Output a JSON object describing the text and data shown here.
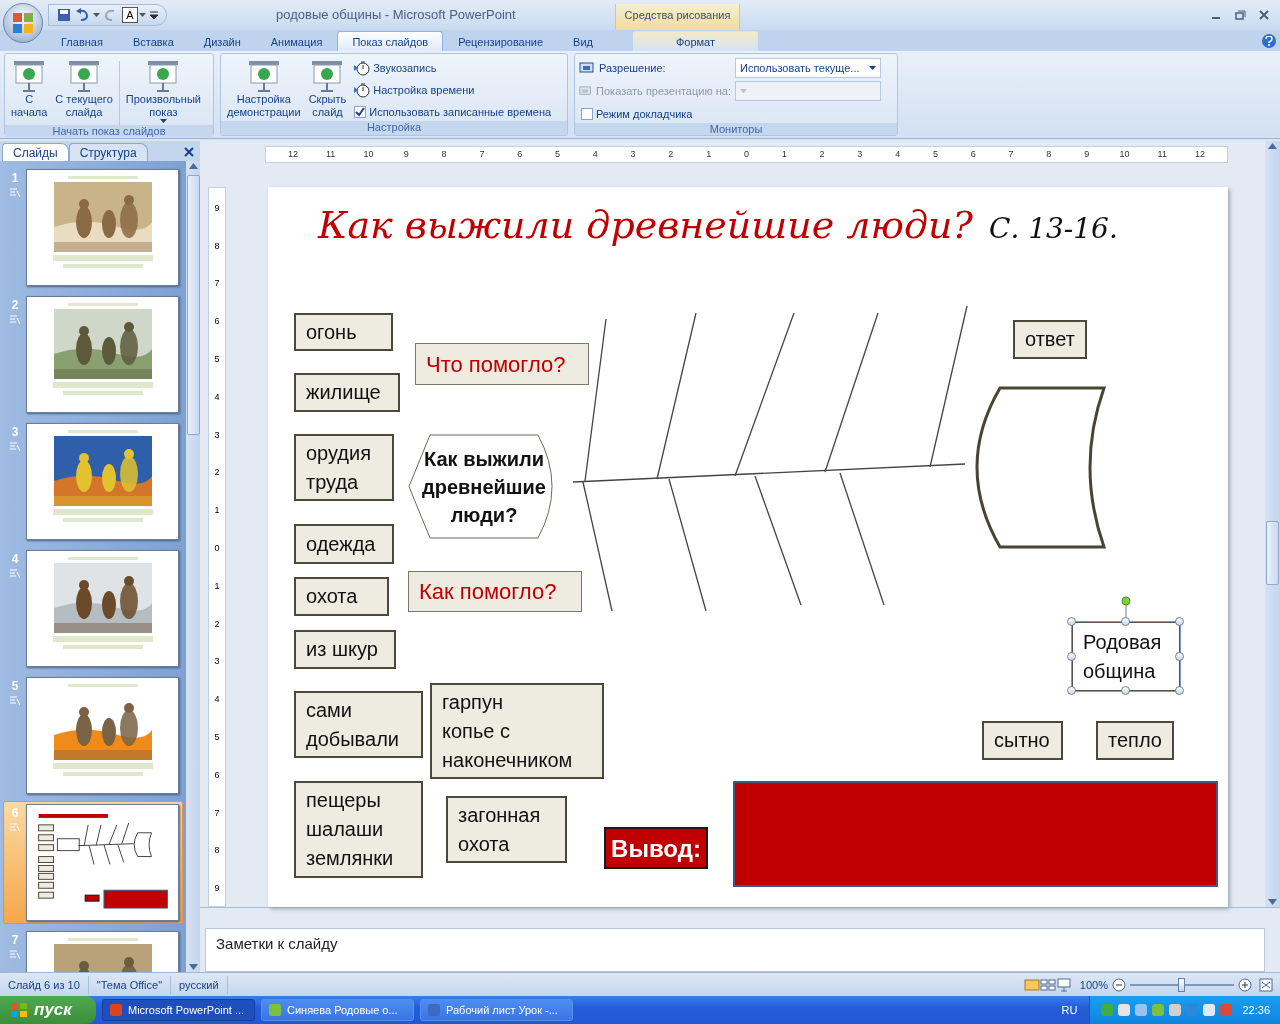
{
  "window": {
    "title": "родовые общины - Microsoft PowerPoint",
    "contextual_tab": "Средства рисования"
  },
  "quick_access": {
    "font_color_letter": "A"
  },
  "ribbon_tabs": [
    {
      "label": "Главная",
      "selected": false,
      "kind": "standard"
    },
    {
      "label": "Вставка",
      "selected": false,
      "kind": "standard"
    },
    {
      "label": "Дизайн",
      "selected": false,
      "kind": "standard"
    },
    {
      "label": "Анимация",
      "selected": false,
      "kind": "standard"
    },
    {
      "label": "Показ слайдов",
      "selected": true,
      "kind": "standard"
    },
    {
      "label": "Рецензирование",
      "selected": false,
      "kind": "standard"
    },
    {
      "label": "Вид",
      "selected": false,
      "kind": "standard"
    },
    {
      "label": "Формат",
      "selected": false,
      "kind": "contextual"
    }
  ],
  "ribbon_groups": [
    {
      "title": "Начать показ слайдов",
      "items": [
        {
          "kind": "large",
          "label": "С\nначала",
          "menu": false
        },
        {
          "kind": "large",
          "label": "С текущего\nслайда",
          "menu": false
        },
        {
          "kind": "separator"
        },
        {
          "kind": "large",
          "label": "Произвольный\nпоказ",
          "menu": true
        }
      ]
    },
    {
      "title": "Настройка",
      "items": [
        {
          "kind": "large",
          "label": "Настройка\nдемонстрации",
          "menu": false
        },
        {
          "kind": "large",
          "label": "Скрыть\nслайд",
          "menu": false
        },
        {
          "kind": "small",
          "label": "Звукозапись"
        },
        {
          "kind": "small",
          "label": "Настройка времени"
        },
        {
          "kind": "checkbox",
          "label": "Использовать записанные времена",
          "checked": true
        }
      ]
    },
    {
      "title": "Мониторы",
      "items": [
        {
          "kind": "dropdown",
          "label": "Разрешение:",
          "value": "Использовать текуще...",
          "disabled": false
        },
        {
          "kind": "dropdown",
          "label": "Показать презентацию на:",
          "disabled": true
        },
        {
          "kind": "checkbox",
          "label": "Режим докладчика",
          "checked": false
        }
      ]
    }
  ],
  "left_pane": {
    "tabs": [
      {
        "label": "Слайды",
        "selected": true
      },
      {
        "label": "Структура",
        "selected": false
      }
    ],
    "slides": [
      {
        "number": "1",
        "kind": "picture",
        "selected": false
      },
      {
        "number": "2",
        "kind": "picture",
        "selected": false
      },
      {
        "number": "3",
        "kind": "picture",
        "selected": false
      },
      {
        "number": "4",
        "kind": "picture",
        "selected": false
      },
      {
        "number": "5",
        "kind": "picture",
        "selected": false
      },
      {
        "number": "6",
        "kind": "diagram",
        "selected": true
      },
      {
        "number": "7",
        "kind": "picture",
        "selected": false
      }
    ]
  },
  "ruler": {
    "horizontal": [
      "12",
      "11",
      "10",
      "9",
      "8",
      "7",
      "6",
      "5",
      "4",
      "3",
      "2",
      "1",
      "0",
      "1",
      "2",
      "3",
      "4",
      "5",
      "6",
      "7",
      "8",
      "9",
      "10",
      "11",
      "12"
    ],
    "vertical": [
      "9",
      "8",
      "7",
      "6",
      "5",
      "4",
      "3",
      "2",
      "1",
      "0",
      "1",
      "2",
      "3",
      "4",
      "5",
      "6",
      "7",
      "8",
      "9"
    ]
  },
  "slide": {
    "title": "Как выжили древнейшие люди?",
    "pages": "С. 13-16.",
    "shapes": [
      {
        "kind": "term",
        "text": "огонь",
        "selected": false
      },
      {
        "kind": "question",
        "text": "Что помогло?",
        "selected": false
      },
      {
        "kind": "term",
        "text": "жилище",
        "selected": false
      },
      {
        "kind": "term",
        "text": "орудия\nтруда",
        "selected": false
      },
      {
        "kind": "center",
        "text": "Как выжили\nдревнейшие\nлюди?",
        "selected": false
      },
      {
        "kind": "term",
        "text": "одежда",
        "selected": false
      },
      {
        "kind": "term",
        "text": "охота",
        "selected": false
      },
      {
        "kind": "question",
        "text": "Как помогло?",
        "selected": false
      },
      {
        "kind": "term",
        "text": "из шкур",
        "selected": false
      },
      {
        "kind": "term",
        "text": "сами\nдобывали",
        "selected": false
      },
      {
        "kind": "term",
        "text": "гарпун\nкопье с\nнаконечником",
        "selected": false
      },
      {
        "kind": "term",
        "text": "пещеры\nшалаши\nземлянки",
        "selected": false
      },
      {
        "kind": "term",
        "text": "загонная\nохота",
        "selected": false
      },
      {
        "kind": "conclusion",
        "text": "Вывод:",
        "selected": false
      },
      {
        "kind": "term",
        "text": "ответ",
        "selected": false
      },
      {
        "kind": "textbox",
        "text": "Родовая\nобщина",
        "selected": true
      },
      {
        "kind": "term",
        "text": "сытно",
        "selected": false
      },
      {
        "kind": "term",
        "text": "тепло",
        "selected": false
      }
    ]
  },
  "notes": {
    "placeholder": "Заметки к слайду"
  },
  "status_bar": {
    "items": [
      "Слайд 6 из 10",
      "\"Тема Office\"",
      "русский"
    ],
    "zoom": "100%",
    "zoom_slider": {
      "level": 0.5
    }
  },
  "taskbar": {
    "start": "пуск",
    "tasks": [
      {
        "label": "Microsoft PowerPoint ...",
        "selected": true
      },
      {
        "label": "Синяева Родовые о...",
        "selected": false
      },
      {
        "label": "Рабочий лист Урок -...",
        "selected": false
      }
    ],
    "language": "RU",
    "clock": "22:36"
  }
}
